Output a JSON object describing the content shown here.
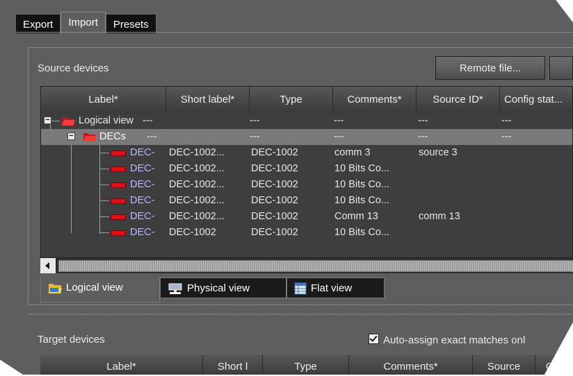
{
  "top_tabs": [
    {
      "label": "Export",
      "active": false
    },
    {
      "label": "Import",
      "active": true
    },
    {
      "label": "Presets",
      "active": false
    }
  ],
  "source": {
    "title": "Source devices",
    "remote_button": "Remote file...",
    "columns": [
      "Label*",
      "Short label*",
      "Type",
      "Comments*",
      "Source ID*",
      "Config stat..."
    ],
    "rows": [
      {
        "label": "Logical view",
        "short": "---",
        "type": "---",
        "comments": "---",
        "source_id": "---",
        "config": "---",
        "kind": "root"
      },
      {
        "label": "DECs",
        "short": "---",
        "type": "---",
        "comments": "---",
        "source_id": "---",
        "config": "---",
        "kind": "folder"
      },
      {
        "label": "DEC-",
        "short": "DEC-1002...",
        "type": "DEC-1002",
        "comments": "comm 3",
        "source_id": "source 3",
        "config": "",
        "kind": "device"
      },
      {
        "label": "DEC-",
        "short": "DEC-1002...",
        "type": "DEC-1002",
        "comments": "10 Bits Co...",
        "source_id": "",
        "config": "",
        "kind": "device"
      },
      {
        "label": "DEC-",
        "short": "DEC-1002...",
        "type": "DEC-1002",
        "comments": "10 Bits Co...",
        "source_id": "",
        "config": "",
        "kind": "device"
      },
      {
        "label": "DEC-",
        "short": "DEC-1002...",
        "type": "DEC-1002",
        "comments": "10 Bits Co...",
        "source_id": "",
        "config": "",
        "kind": "device"
      },
      {
        "label": "DEC-",
        "short": "DEC-1002...",
        "type": "DEC-1002",
        "comments": "Comm 13",
        "source_id": "comm 13",
        "config": "",
        "kind": "device"
      },
      {
        "label": "DEC-",
        "short": "DEC-1002",
        "type": "DEC-1002",
        "comments": "10 Bits Co...",
        "source_id": "",
        "config": "",
        "kind": "device"
      }
    ],
    "view_tabs": [
      {
        "label": "Logical view",
        "icon": "folder-icon",
        "active": true
      },
      {
        "label": "Physical view",
        "icon": "network-icon",
        "active": false
      },
      {
        "label": "Flat view",
        "icon": "table-icon",
        "active": false
      }
    ]
  },
  "target": {
    "title": "Target devices",
    "auto_assign_label": "Auto-assign exact matches onl",
    "auto_assign_checked": true,
    "columns": [
      "Label*",
      "Short l",
      "Type",
      "Comments*",
      "Source",
      "Co"
    ]
  },
  "colors": {
    "device_red": "#e0101a",
    "folder_red": "#e8262a",
    "label_blue": "#b8b8ff"
  }
}
